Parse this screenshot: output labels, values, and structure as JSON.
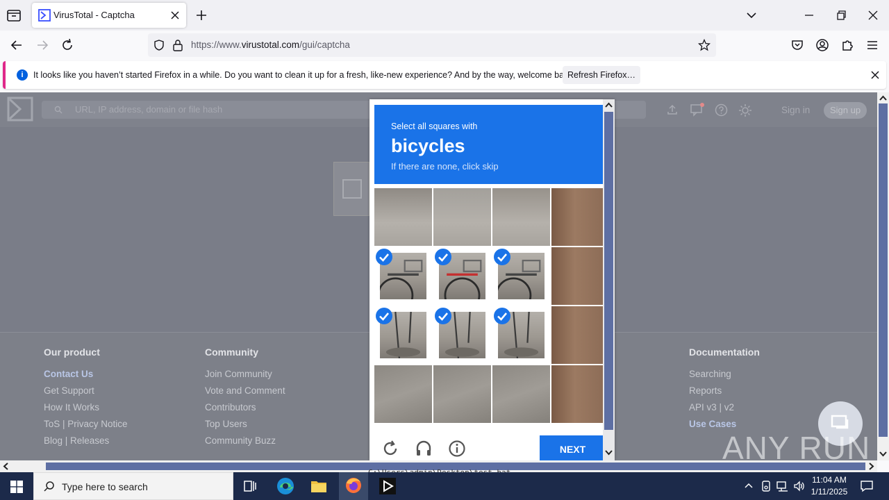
{
  "browser": {
    "tab_title": "VirusTotal - Captcha",
    "url_prefix": "https://www.",
    "url_domain": "virustotal.com",
    "url_path": "/gui/captcha"
  },
  "notification": {
    "text": "It looks like you haven’t started Firefox in a while. Do you want to clean it up for a fresh, like-new experience? And by the way, welcome back!",
    "button": "Refresh Firefox…"
  },
  "vt": {
    "search_placeholder": "URL, IP address, domain or file hash",
    "sign_in": "Sign in",
    "sign_up": "Sign up"
  },
  "footer": {
    "columns": [
      {
        "heading": "Our product",
        "items": [
          "Contact Us",
          "Get Support",
          "How It Works",
          "ToS | Privacy Notice",
          "Blog | Releases"
        ]
      },
      {
        "heading": "Community",
        "items": [
          "Join Community",
          "Vote and Comment",
          "Contributors",
          "Top Users",
          "Community Buzz"
        ]
      },
      {
        "heading": "Documentation",
        "items": [
          "Searching",
          "Reports",
          "API v3 | v2",
          "Use Cases"
        ]
      }
    ]
  },
  "captcha": {
    "instruction": "Select all squares with",
    "target": "bicycles",
    "hint": "If there are none, click skip",
    "next_label": "NEXT",
    "selected": [
      4,
      5,
      6,
      8,
      9,
      10
    ],
    "accent": "#1a73e8"
  },
  "watermark": "ANY RUN",
  "console_line": "C:\\Users\\admin\\Desktop\\test.bat",
  "taskbar": {
    "search_placeholder": "Type here to search",
    "time": "11:04 AM",
    "date": "1/11/2025"
  }
}
